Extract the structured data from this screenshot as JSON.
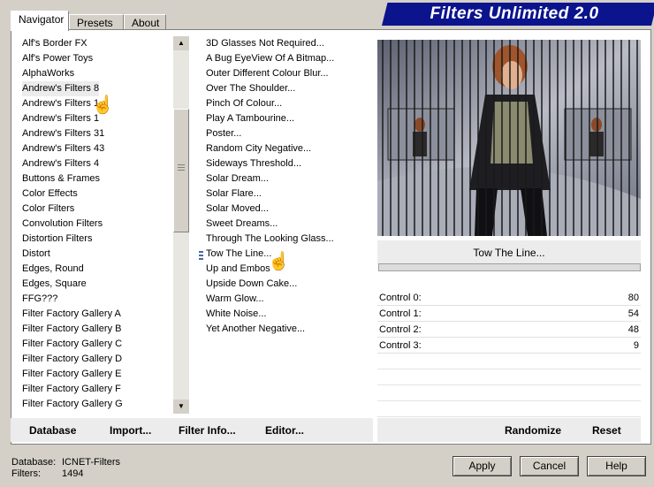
{
  "title": "Filters Unlimited 2.0",
  "tabs": [
    "Navigator",
    "Presets",
    "About"
  ],
  "categories": [
    "Alf's Border FX",
    "Alf's Power Toys",
    "AlphaWorks",
    "Andrew's Filters 8",
    "Andrew's Filters 1",
    "Andrew's Filters 1",
    "Andrew's Filters 31",
    "Andrew's Filters 43",
    "Andrew's Filters 4",
    "Buttons & Frames",
    "Color Effects",
    "Color Filters",
    "Convolution Filters",
    "Distortion Filters",
    "Distort",
    "Edges, Round",
    "Edges, Square",
    "FFG???",
    "Filter Factory Gallery A",
    "Filter Factory Gallery B",
    "Filter Factory Gallery C",
    "Filter Factory Gallery D",
    "Filter Factory Gallery E",
    "Filter Factory Gallery F",
    "Filter Factory Gallery G"
  ],
  "filters": [
    "3D Glasses Not Required...",
    "A Bug EyeView Of A Bitmap...",
    "Outer Different Colour Blur...",
    "Over The Shoulder...",
    "Pinch Of Colour...",
    "Play A Tambourine...",
    "Poster...",
    "Random City Negative...",
    "Sideways Threshold...",
    "Solar Dream...",
    "Solar Flare...",
    "Solar Moved...",
    "Sweet Dreams...",
    "Through The Looking Glass...",
    "Tow The Line...",
    "Up and Embos",
    "Upside Down Cake...",
    "Warm Glow...",
    "White Noise...",
    "Yet Another Negative..."
  ],
  "selected_filter": "Tow The Line...",
  "bottom_left_buttons": [
    "Database",
    "Import...",
    "Filter Info...",
    "Editor..."
  ],
  "bottom_right_buttons": [
    "Randomize",
    "Reset"
  ],
  "controls": [
    {
      "label": "Control 0:",
      "value": "80"
    },
    {
      "label": "Control 1:",
      "value": "54"
    },
    {
      "label": "Control 2:",
      "value": "48"
    },
    {
      "label": "Control 3:",
      "value": "9"
    }
  ],
  "status": {
    "database_label": "Database:",
    "database_value": "ICNET-Filters",
    "filters_label": "Filters:",
    "filters_value": "1494"
  },
  "dialog_buttons": [
    "Apply",
    "Cancel",
    "Help"
  ],
  "colors": {
    "title_bar": "#0b148c",
    "face": "#d4d0c8"
  }
}
